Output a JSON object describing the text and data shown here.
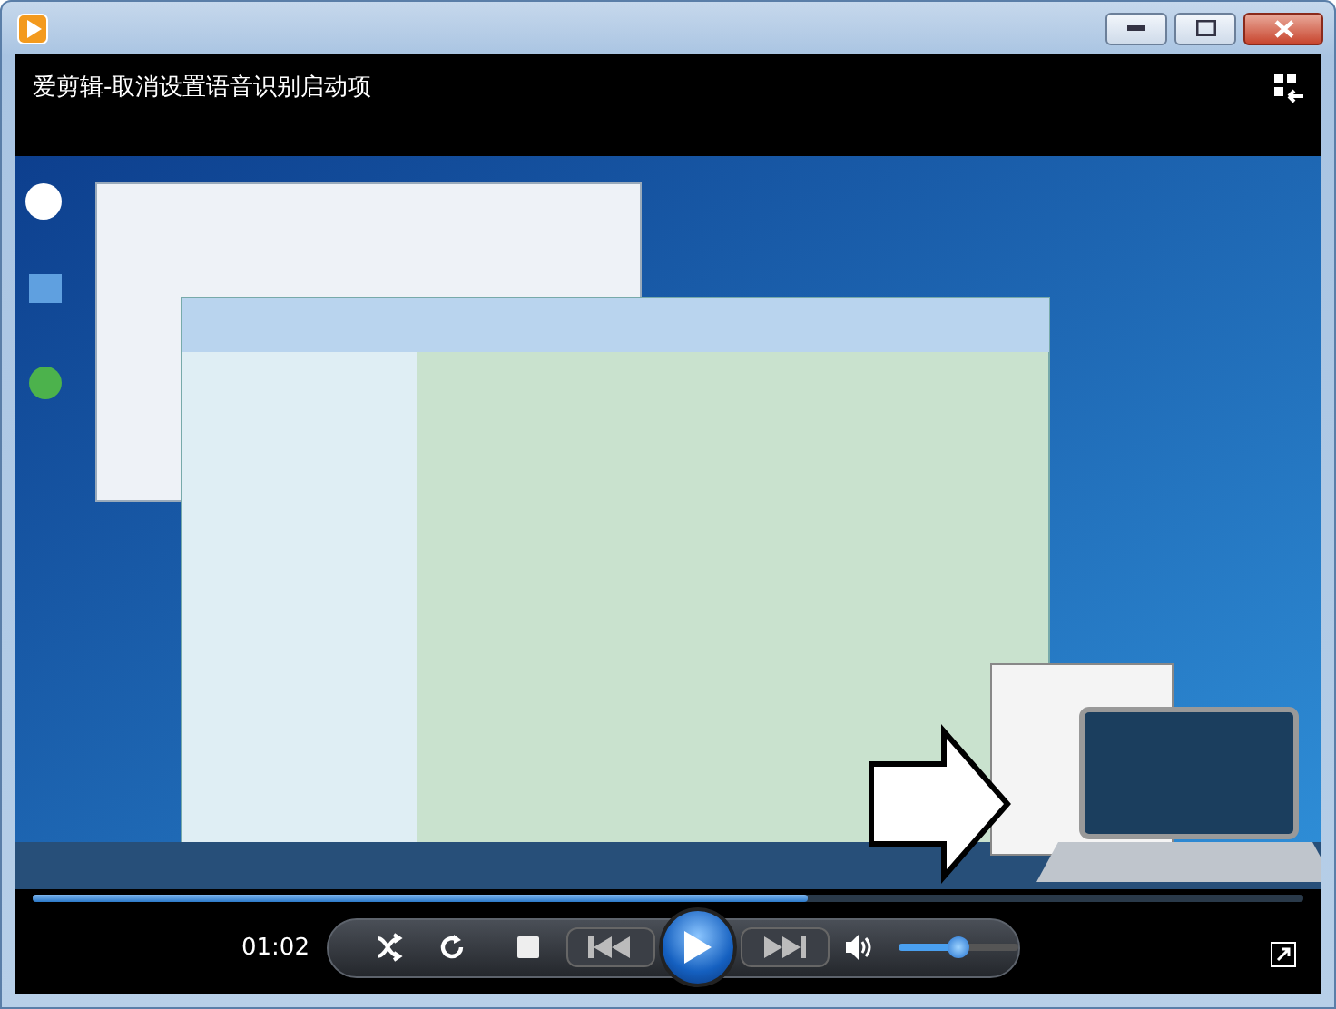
{
  "window": {
    "title": "爱剪辑-取消设置语音识别启动项"
  },
  "player": {
    "progress": {
      "level": 0.61
    },
    "time": "01:02",
    "volume": {
      "level": 0.5
    }
  }
}
